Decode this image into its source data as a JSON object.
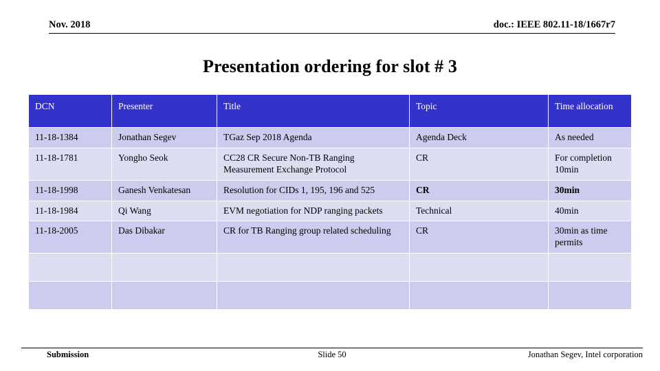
{
  "header": {
    "left": "Nov. 2018",
    "right": "doc.: IEEE 802.11-18/1667r7"
  },
  "title": "Presentation ordering for slot # 3",
  "table": {
    "columns": [
      "DCN",
      "Presenter",
      "Title",
      "Topic",
      "Time allocation"
    ],
    "header_bg": "#3333CC",
    "header_fg": "#FFFFFF",
    "band_colors": [
      "#CCCCEE",
      "#DDDDF2"
    ],
    "rows": [
      {
        "dcn": "11-18-1384",
        "presenter": "Jonathan Segev",
        "title": "TGaz Sep 2018 Agenda",
        "topic": "Agenda Deck",
        "time": "As needed"
      },
      {
        "dcn": "11-18-1781",
        "presenter": "Yongho Seok",
        "title": "CC28 CR Secure Non-TB Ranging Measurement Exchange Protocol",
        "topic": "CR",
        "time": "For completion 10min"
      },
      {
        "dcn": "11-18-1998",
        "presenter": "Ganesh Venkatesan",
        "title": "Resolution for CIDs 1, 195, 196 and 525",
        "topic": "CR",
        "time": "30min"
      },
      {
        "dcn": "11-18-1984",
        "presenter": "Qi Wang",
        "title": "EVM negotiation for NDP ranging packets",
        "topic": "Technical",
        "time": "40min"
      },
      {
        "dcn": "11-18-2005",
        "presenter": "Das Dibakar",
        "title": "CR for TB Ranging group related scheduling",
        "topic": "CR",
        "time": "30min as time permits"
      },
      {
        "dcn": "",
        "presenter": "",
        "title": "",
        "topic": "",
        "time": ""
      },
      {
        "dcn": "",
        "presenter": "",
        "title": "",
        "topic": "",
        "time": ""
      }
    ]
  },
  "footer": {
    "left": "Submission",
    "center": "Slide 50",
    "right": "Jonathan Segev, Intel corporation"
  }
}
